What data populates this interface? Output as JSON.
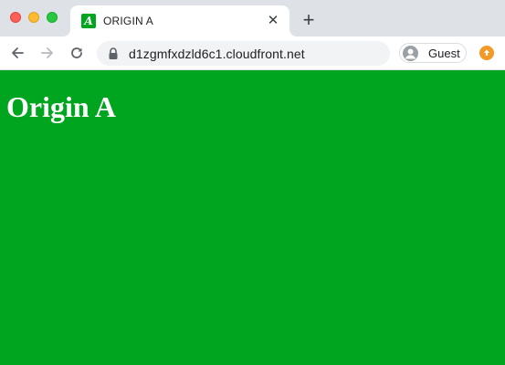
{
  "window": {
    "controls": [
      "close",
      "minimize",
      "maximize"
    ]
  },
  "tab": {
    "favicon_letter": "A",
    "title": "ORIGIN A",
    "close_glyph": "✕"
  },
  "new_tab_glyph": "+",
  "toolbar": {
    "back_icon": "arrow-left-icon",
    "forward_icon": "arrow-right-icon",
    "reload_icon": "reload-icon",
    "url": "d1zgmfxdzld6c1.cloudfront.net",
    "profile_label": "Guest",
    "update_icon": "update-arrow-icon"
  },
  "page": {
    "heading": "Origin A",
    "background_color": "#00a51f",
    "heading_color": "#ffffff"
  }
}
